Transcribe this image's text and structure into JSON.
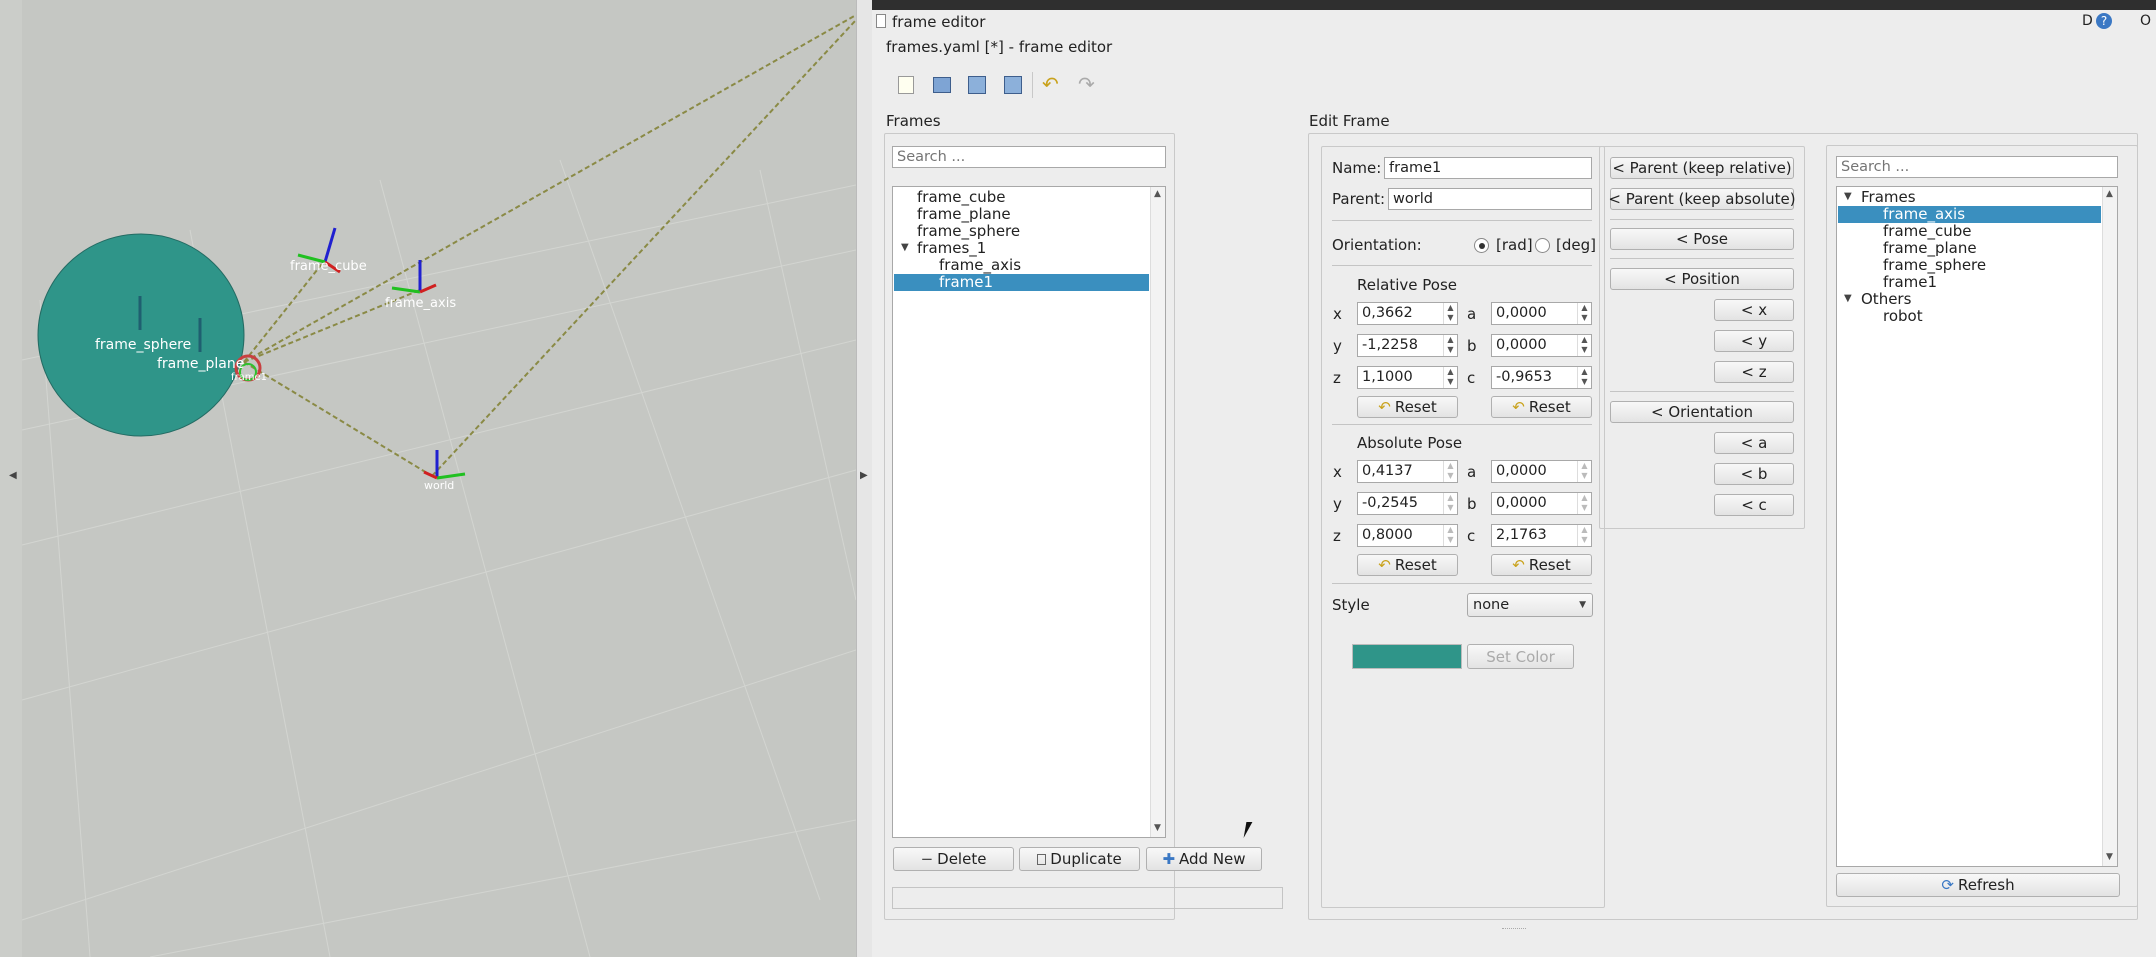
{
  "viewport": {
    "labels": {
      "frame_cube": "frame_cube",
      "frame_axis": "frame_axis",
      "frame_sphere": "frame_sphere",
      "frame_plane": "frame_plane",
      "frame1": "frame1",
      "world": "world"
    },
    "sphere_color": "#2f9589",
    "floor_color": "#c4c6c2"
  },
  "window": {
    "title": "frame editor",
    "subtitle": "frames.yaml [*] - frame editor",
    "title_buttons": "D",
    "help": "?",
    "close": "O"
  },
  "toolbar": {
    "icons": [
      "new-file-icon",
      "open-file-icon",
      "save-icon",
      "save-as-icon",
      "undo-icon",
      "redo-icon"
    ]
  },
  "frames_panel": {
    "title": "Frames",
    "search_placeholder": "Search ...",
    "tree": [
      {
        "label": "frame_cube",
        "depth": 0
      },
      {
        "label": "frame_plane",
        "depth": 0
      },
      {
        "label": "frame_sphere",
        "depth": 0
      },
      {
        "label": "frames_1",
        "depth": 0,
        "expanded": true
      },
      {
        "label": "frame_axis",
        "depth": 1
      },
      {
        "label": "frame1",
        "depth": 1,
        "selected": true
      }
    ],
    "delete": "Delete",
    "duplicate": "Duplicate",
    "add_new": "Add New"
  },
  "edit": {
    "title": "Edit Frame",
    "name_label": "Name:",
    "name_value": "frame1",
    "parent_label": "Parent:",
    "parent_value": "world",
    "orientation_label": "Orientation:",
    "rad": "[rad]",
    "deg": "[deg]",
    "orientation_unit": "rad",
    "relative_title": "Relative Pose",
    "relative": {
      "x": "0,3662",
      "y": "-1,2258",
      "z": "1,1000",
      "a": "0,0000",
      "b": "0,0000",
      "c": "-0,9653"
    },
    "absolute_title": "Absolute Pose",
    "absolute": {
      "x": "0,4137",
      "y": "-0,2545",
      "z": "0,8000",
      "a": "0,0000",
      "b": "0,0000",
      "c": "2,1763"
    },
    "axes": {
      "x": "x",
      "y": "y",
      "z": "z",
      "a": "a",
      "b": "b",
      "c": "c"
    },
    "reset": "Reset",
    "style_label": "Style",
    "style_value": "none",
    "color": "#2f9589",
    "set_color": "Set Color"
  },
  "copy": {
    "parent_rel": "< Parent (keep relative)",
    "parent_abs": "< Parent (keep absolute)",
    "pose": "< Pose",
    "position": "< Position",
    "x": "< x",
    "y": "< y",
    "z": "< z",
    "orientation": "< Orientation",
    "a": "< a",
    "b": "< b",
    "c": "< c"
  },
  "right_tree": {
    "search_placeholder": "Search ...",
    "items": [
      {
        "label": "Frames",
        "depth": 0,
        "expanded": true
      },
      {
        "label": "frame_axis",
        "depth": 1,
        "selected": true
      },
      {
        "label": "frame_cube",
        "depth": 1
      },
      {
        "label": "frame_plane",
        "depth": 1
      },
      {
        "label": "frame_sphere",
        "depth": 1
      },
      {
        "label": "frame1",
        "depth": 1
      },
      {
        "label": "Others",
        "depth": 0,
        "expanded": true
      },
      {
        "label": "robot",
        "depth": 1
      }
    ],
    "refresh": "Refresh"
  }
}
